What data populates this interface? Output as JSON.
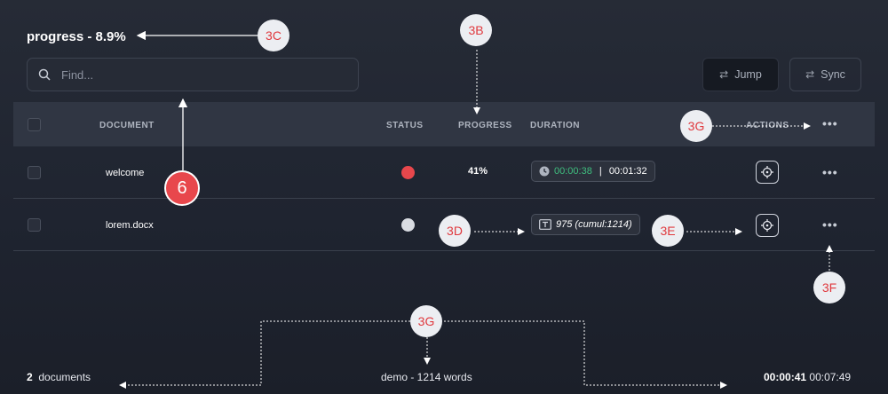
{
  "title": "progress - 8.9%",
  "search": {
    "placeholder": "Find..."
  },
  "toolbar": {
    "jump_label": "Jump",
    "sync_label": "Sync"
  },
  "table": {
    "headers": {
      "document": "DOCUMENT",
      "status": "STATUS",
      "progress": "PROGRESS",
      "duration": "DURATION",
      "actions": "ACTIONS"
    },
    "rows": [
      {
        "document": "welcome",
        "status_color": "#e8474c",
        "progress": "41%",
        "duration_elapsed": "00:00:38",
        "duration_sep": " | ",
        "duration_total": "00:01:32"
      },
      {
        "document": "lorem.docx",
        "status_color": "#d9dce2",
        "words": "975 (cumul:1214)"
      }
    ]
  },
  "footer": {
    "count": "2",
    "count_label": "documents",
    "middle": "demo - 1214 words",
    "elapsed": "00:00:41",
    "total": "00:07:49"
  },
  "annotations": {
    "c3C": "3C",
    "c3B": "3B",
    "c3G_top": "3G",
    "c6": "6",
    "c3D": "3D",
    "c3E": "3E",
    "c3F": "3F",
    "c3G_bottom": "3G"
  },
  "colors": {
    "accent_red": "#e8474c",
    "timer_green": "#3fbf7f",
    "header_bg": "#303643"
  }
}
